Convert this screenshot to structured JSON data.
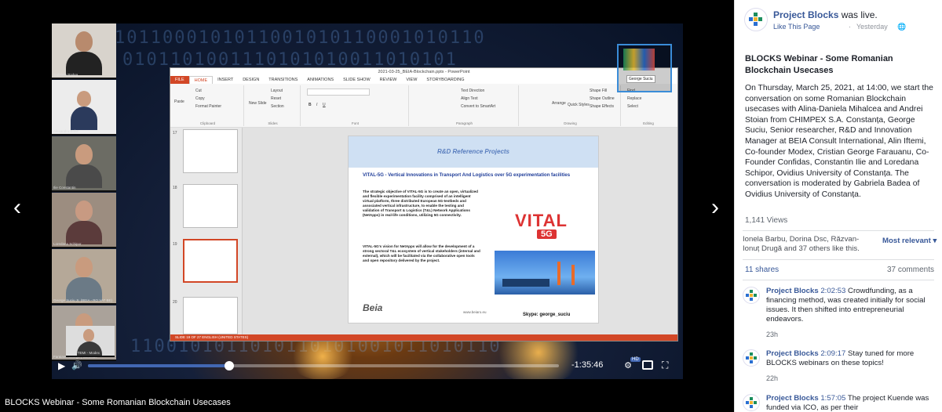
{
  "colors": {
    "brand": "#385898",
    "progress": "#4267b2",
    "ppt": "#d24726"
  },
  "video": {
    "title": "BLOCKS Webinar - Some Romanian Blockchain Usecases",
    "time_remaining": "-1:35:46",
    "progress_fraction": 0.3,
    "hd_badge": "HD",
    "participants": [
      {
        "name": "Gabriela Badea"
      },
      {
        "name": "Alexandru Bolut"
      },
      {
        "name": "Ilie Constantin"
      },
      {
        "name": "Loredana Schipor"
      },
      {
        "name": "George Suciu Jr. (BEIA - RO VAT BE)"
      },
      {
        "name": "Faraianu George | Confidas"
      },
      {
        "name": "Alin IFTEMI - Modex"
      }
    ],
    "ppt": {
      "window_title": "2021-03-25_BEIA-Blockchain.pptx - PowerPoint",
      "tabs": [
        "FILE",
        "HOME",
        "INSERT",
        "DESIGN",
        "TRANSITIONS",
        "ANIMATIONS",
        "SLIDE SHOW",
        "REVIEW",
        "VIEW",
        "STORYBOARDING"
      ],
      "ribbon": {
        "paste": "Paste",
        "cut": "Cut",
        "copy": "Copy",
        "format_painter": "Format Painter",
        "new_slide": "New Slide",
        "layout": "Layout",
        "reset": "Reset",
        "section": "Section",
        "text_direction": "Text Direction",
        "align_text": "Align Text",
        "smartart": "Convert to SmartArt",
        "shape_fill": "Shape Fill",
        "shape_outline": "Shape Outline",
        "shape_effects": "Shape Effects",
        "arrange": "Arrange",
        "quick_styles": "Quick Styles",
        "find": "Find",
        "replace": "Replace",
        "select": "Select",
        "groups": {
          "clipboard": "Clipboard",
          "slides": "Slides",
          "font": "Font",
          "paragraph": "Paragraph",
          "drawing": "Drawing",
          "editing": "Editing"
        }
      },
      "thumb_numbers": [
        "17",
        "18",
        "19",
        "20"
      ],
      "slide": {
        "header": "R&D Reference Projects",
        "headline": "VITAL-5G - Vertical Innovations in Transport And Logistics over 5G experimentation facilities",
        "para1": "The strategic objective of VITAL-5G is to create an open, virtualized and flexible experimentation facility comprised of an intelligent virtual platform, three distributed European 5G-testbeds and associated vertical infrastructure, to enable the testing and validation of Transport & Logistics (T&L) Network Applications (NetApps) in real-life conditions, utilizing 5G connectivity.",
        "para2": "VITAL-5G's vision for NetApps will allow for the development of a strong sectoral T&L ecosystem of vertical stakeholders (internal and external), which will be facilitated via the collaborative open tools and open repository delivered by the project.",
        "logo_text": "VITAL",
        "logo_sub": "5G",
        "beia": "Beia",
        "beia_url": "www.beiaro.eu",
        "skype": "Skype: george_suciu"
      },
      "status_bar": "SLIDE 19 OF 27    ENGLISH (UNITED STATES)"
    },
    "speaker_label": "George Suciu"
  },
  "post": {
    "page_name": "Project Blocks",
    "status": " was live.",
    "like_page": "Like This Page",
    "separator": "·",
    "time": "Yesterday",
    "globe": "🌐",
    "title": "BLOCKS Webinar - Some Romanian Blockchain Usecases",
    "body": "On Thursday, March 25, 2021, at 14:00, we start the conversation on some Romanian Blockchain usecases with Alina-Daniela Mihalcea and Andrei Stoian from CHIMPEX S.A. Constanța, George Suciu, Senior researcher, R&D and Innovation Manager at BEIA Consult International, Alin Iftemi, Co-founder Modex, Cristian George Farauanu, Co-Founder Confidas, Constantin Ilie and Loredana Schipor, Ovidius University of Constanța. The conversation is moderated by Gabriela Badea of Ovidius University of Constanța.",
    "views": "1,141 Views",
    "likes": "Ionela Barbu, Dorina Dsc, Răzvan-Ionuț Drugă and 37 others like this.",
    "sort": "Most relevant ▾",
    "shares": "11 shares",
    "comments_count": "37 comments",
    "comments": [
      {
        "author": "Project Blocks",
        "stamp": "2:02:53",
        "text": " Crowdfunding, as a financing method, was created initially for social issues. It then shifted into entrepreneurial endeavors.",
        "time": "23h"
      },
      {
        "author": "Project Blocks",
        "stamp": "2:09:17",
        "text": " Stay tuned for more BLOCKS webinars on these topics!",
        "time": "22h"
      },
      {
        "author": "Project Blocks",
        "stamp": "1:57:05",
        "text": " The project Kuende was funded via ICO, as per their",
        "time": ""
      }
    ]
  }
}
